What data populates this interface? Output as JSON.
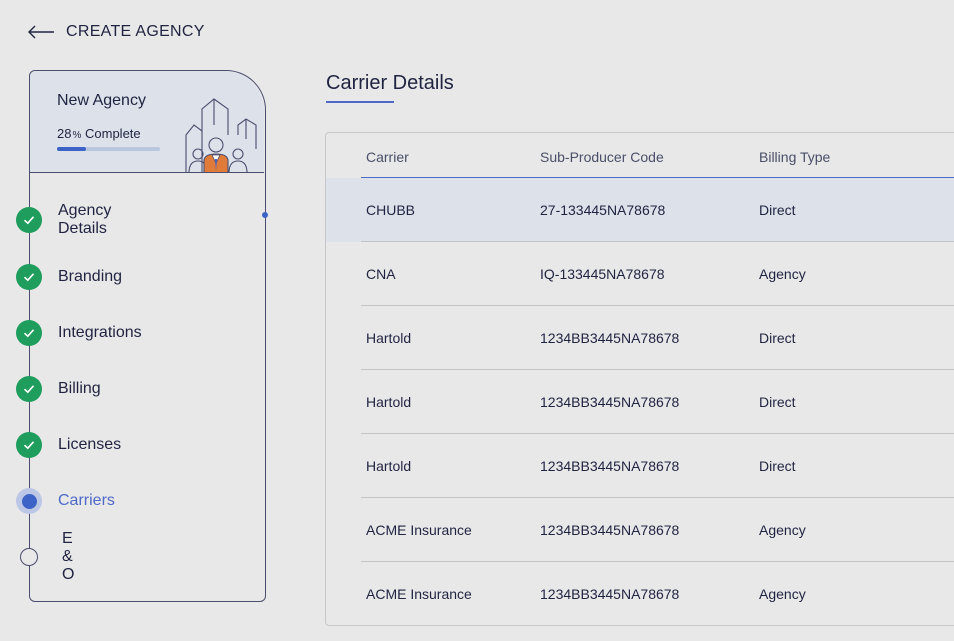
{
  "header": {
    "title": "CREATE AGENCY"
  },
  "agency": {
    "name": "New Agency",
    "progress_value": "28",
    "progress_unit": "%",
    "progress_suffix": "Complete",
    "progress_fraction": 0.28
  },
  "steps": [
    {
      "label": "Agency Details",
      "status": "done"
    },
    {
      "label": "Branding",
      "status": "done"
    },
    {
      "label": "Integrations",
      "status": "done"
    },
    {
      "label": "Billing",
      "status": "done"
    },
    {
      "label": "Licenses",
      "status": "done"
    },
    {
      "label": "Carriers",
      "status": "active"
    },
    {
      "label": "E & O",
      "status": "todo"
    }
  ],
  "main": {
    "section_title": "Carrier Details",
    "table": {
      "columns": [
        "Carrier",
        "Sub-Producer Code",
        "Billing Type"
      ],
      "rows": [
        {
          "carrier": "CHUBB",
          "code": "27-133445NA78678",
          "billing": "Direct",
          "selected": true
        },
        {
          "carrier": "CNA",
          "code": "IQ-133445NA78678",
          "billing": "Agency",
          "selected": false
        },
        {
          "carrier": "Hartold",
          "code": "1234BB3445NA78678",
          "billing": "Direct",
          "selected": false
        },
        {
          "carrier": "Hartold",
          "code": "1234BB3445NA78678",
          "billing": "Direct",
          "selected": false
        },
        {
          "carrier": "Hartold",
          "code": "1234BB3445NA78678",
          "billing": "Direct",
          "selected": false
        },
        {
          "carrier": "ACME Insurance",
          "code": "1234BB3445NA78678",
          "billing": "Agency",
          "selected": false
        },
        {
          "carrier": "ACME Insurance",
          "code": "1234BB3445NA78678",
          "billing": "Agency",
          "selected": false
        }
      ]
    }
  },
  "colors": {
    "accent": "#3e63c7",
    "done_green": "#1e9d5c",
    "text_dark": "#1f2340",
    "selected_row": "#dde2ea",
    "background": "#e8e8e8"
  },
  "icons": {
    "back": "arrow-left-icon",
    "done": "check-circle-icon",
    "active": "active-dot-icon",
    "todo": "empty-circle-icon",
    "illustration": "team-buildings-illustration"
  }
}
